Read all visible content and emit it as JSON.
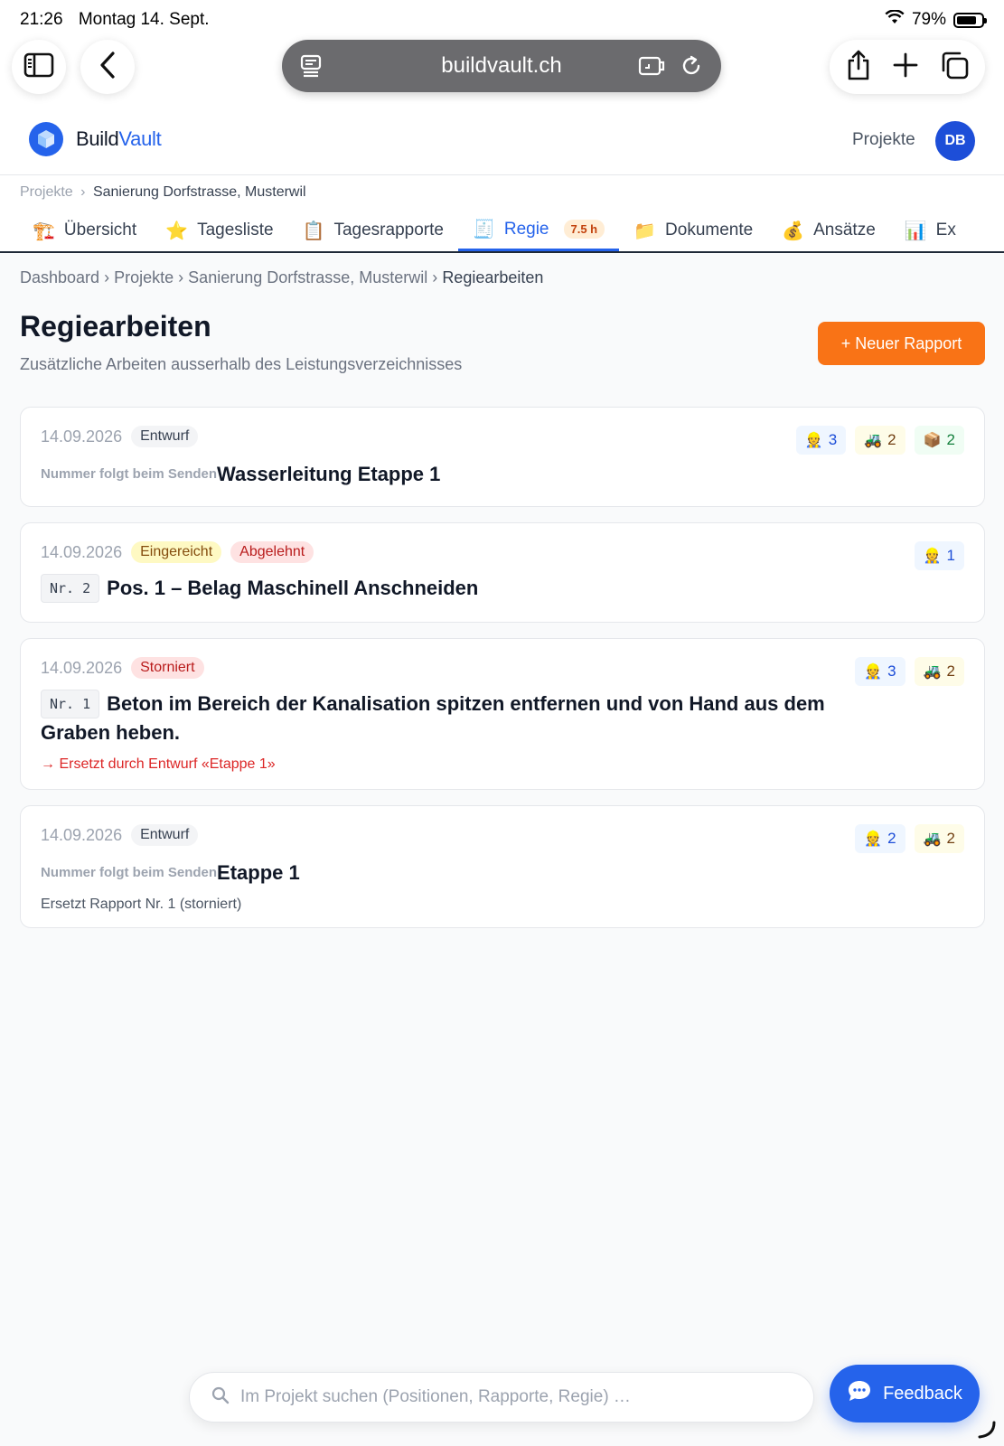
{
  "statusbar": {
    "time": "21:26",
    "date": "Montag 14. Sept.",
    "battery": "79%",
    "battery_level": 0.79
  },
  "browser": {
    "url": "buildvault.ch"
  },
  "app": {
    "brand_part1": "Build",
    "brand_part2": "Vault",
    "nav_projects": "Projekte",
    "user_initials": "DB",
    "brand_color": "#2563eb",
    "accent_color": "#f97316"
  },
  "project_nav": {
    "breadcrumb": [
      "Projekte",
      "Sanierung Dorfstrasse, Musterwil"
    ],
    "separator": "›",
    "tabs": [
      {
        "icon": "🏗️",
        "label": "Übersicht"
      },
      {
        "icon": "⭐",
        "label": "Tagesliste"
      },
      {
        "icon": "📋",
        "label": "Tagesrapporte"
      },
      {
        "icon": "🧾",
        "label": "Regie",
        "badge": "7.5 h",
        "active": true
      },
      {
        "icon": "📁",
        "label": "Dokumente"
      },
      {
        "icon": "💰",
        "label": "Ansätze"
      },
      {
        "icon": "📊",
        "label": "Ex"
      }
    ]
  },
  "breadcrumb": [
    "Dashboard",
    "Projekte",
    "Sanierung Dorfstrasse, Musterwil",
    "Regiearbeiten"
  ],
  "page": {
    "title": "Regiearbeiten",
    "subtitle": "Zusätzliche Arbeiten ausserhalb des Leistungsverzeichnisses",
    "new_button": "+ Neuer Rapport"
  },
  "reports": [
    {
      "date": "14.09.2026",
      "badges": [
        {
          "text": "Entwurf",
          "tone": "gray"
        }
      ],
      "number": "",
      "pending_text": "Nummer folgt beim Senden",
      "title": "Wasserleitung Etappe 1",
      "chips": [
        {
          "icon": "👷",
          "count": "3",
          "tone": "blue"
        },
        {
          "icon": "🚜",
          "count": "2",
          "tone": "yellow"
        },
        {
          "icon": "📦",
          "count": "2",
          "tone": "green"
        }
      ],
      "note": ""
    },
    {
      "date": "14.09.2026",
      "badges": [
        {
          "text": "Eingereicht",
          "tone": "yellow"
        },
        {
          "text": "Abgelehnt",
          "tone": "red"
        }
      ],
      "number": "Nr. 2",
      "pending_text": "",
      "title": "Pos. 1 – Belag Maschinell Anschneiden",
      "chips": [
        {
          "icon": "👷",
          "count": "1",
          "tone": "blue"
        }
      ],
      "note": ""
    },
    {
      "date": "14.09.2026",
      "badges": [
        {
          "text": "Storniert",
          "tone": "red"
        }
      ],
      "number": "Nr. 1",
      "pending_text": "",
      "title": "Beton im Bereich der Kanalisation spitzen entfernen und von Hand aus dem Graben heben.",
      "chips": [
        {
          "icon": "👷",
          "count": "3",
          "tone": "blue"
        },
        {
          "icon": "🚜",
          "count": "2",
          "tone": "yellow"
        }
      ],
      "note": "→ Ersetzt durch Entwurf «Etappe 1»",
      "note_tone": "red"
    },
    {
      "date": "14.09.2026",
      "badges": [
        {
          "text": "Entwurf",
          "tone": "gray"
        }
      ],
      "number": "",
      "pending_text": "Nummer folgt beim Senden",
      "title": "Etappe 1",
      "chips": [
        {
          "icon": "👷",
          "count": "2",
          "tone": "blue"
        },
        {
          "icon": "🚜",
          "count": "2",
          "tone": "yellow"
        }
      ],
      "note": "Ersetzt Rapport Nr. 1 (storniert)",
      "note_tone": "gray"
    }
  ],
  "search": {
    "placeholder": "Im Projekt suchen (Positionen, Rapporte, Regie) …"
  },
  "feedback": {
    "label": "Feedback"
  }
}
